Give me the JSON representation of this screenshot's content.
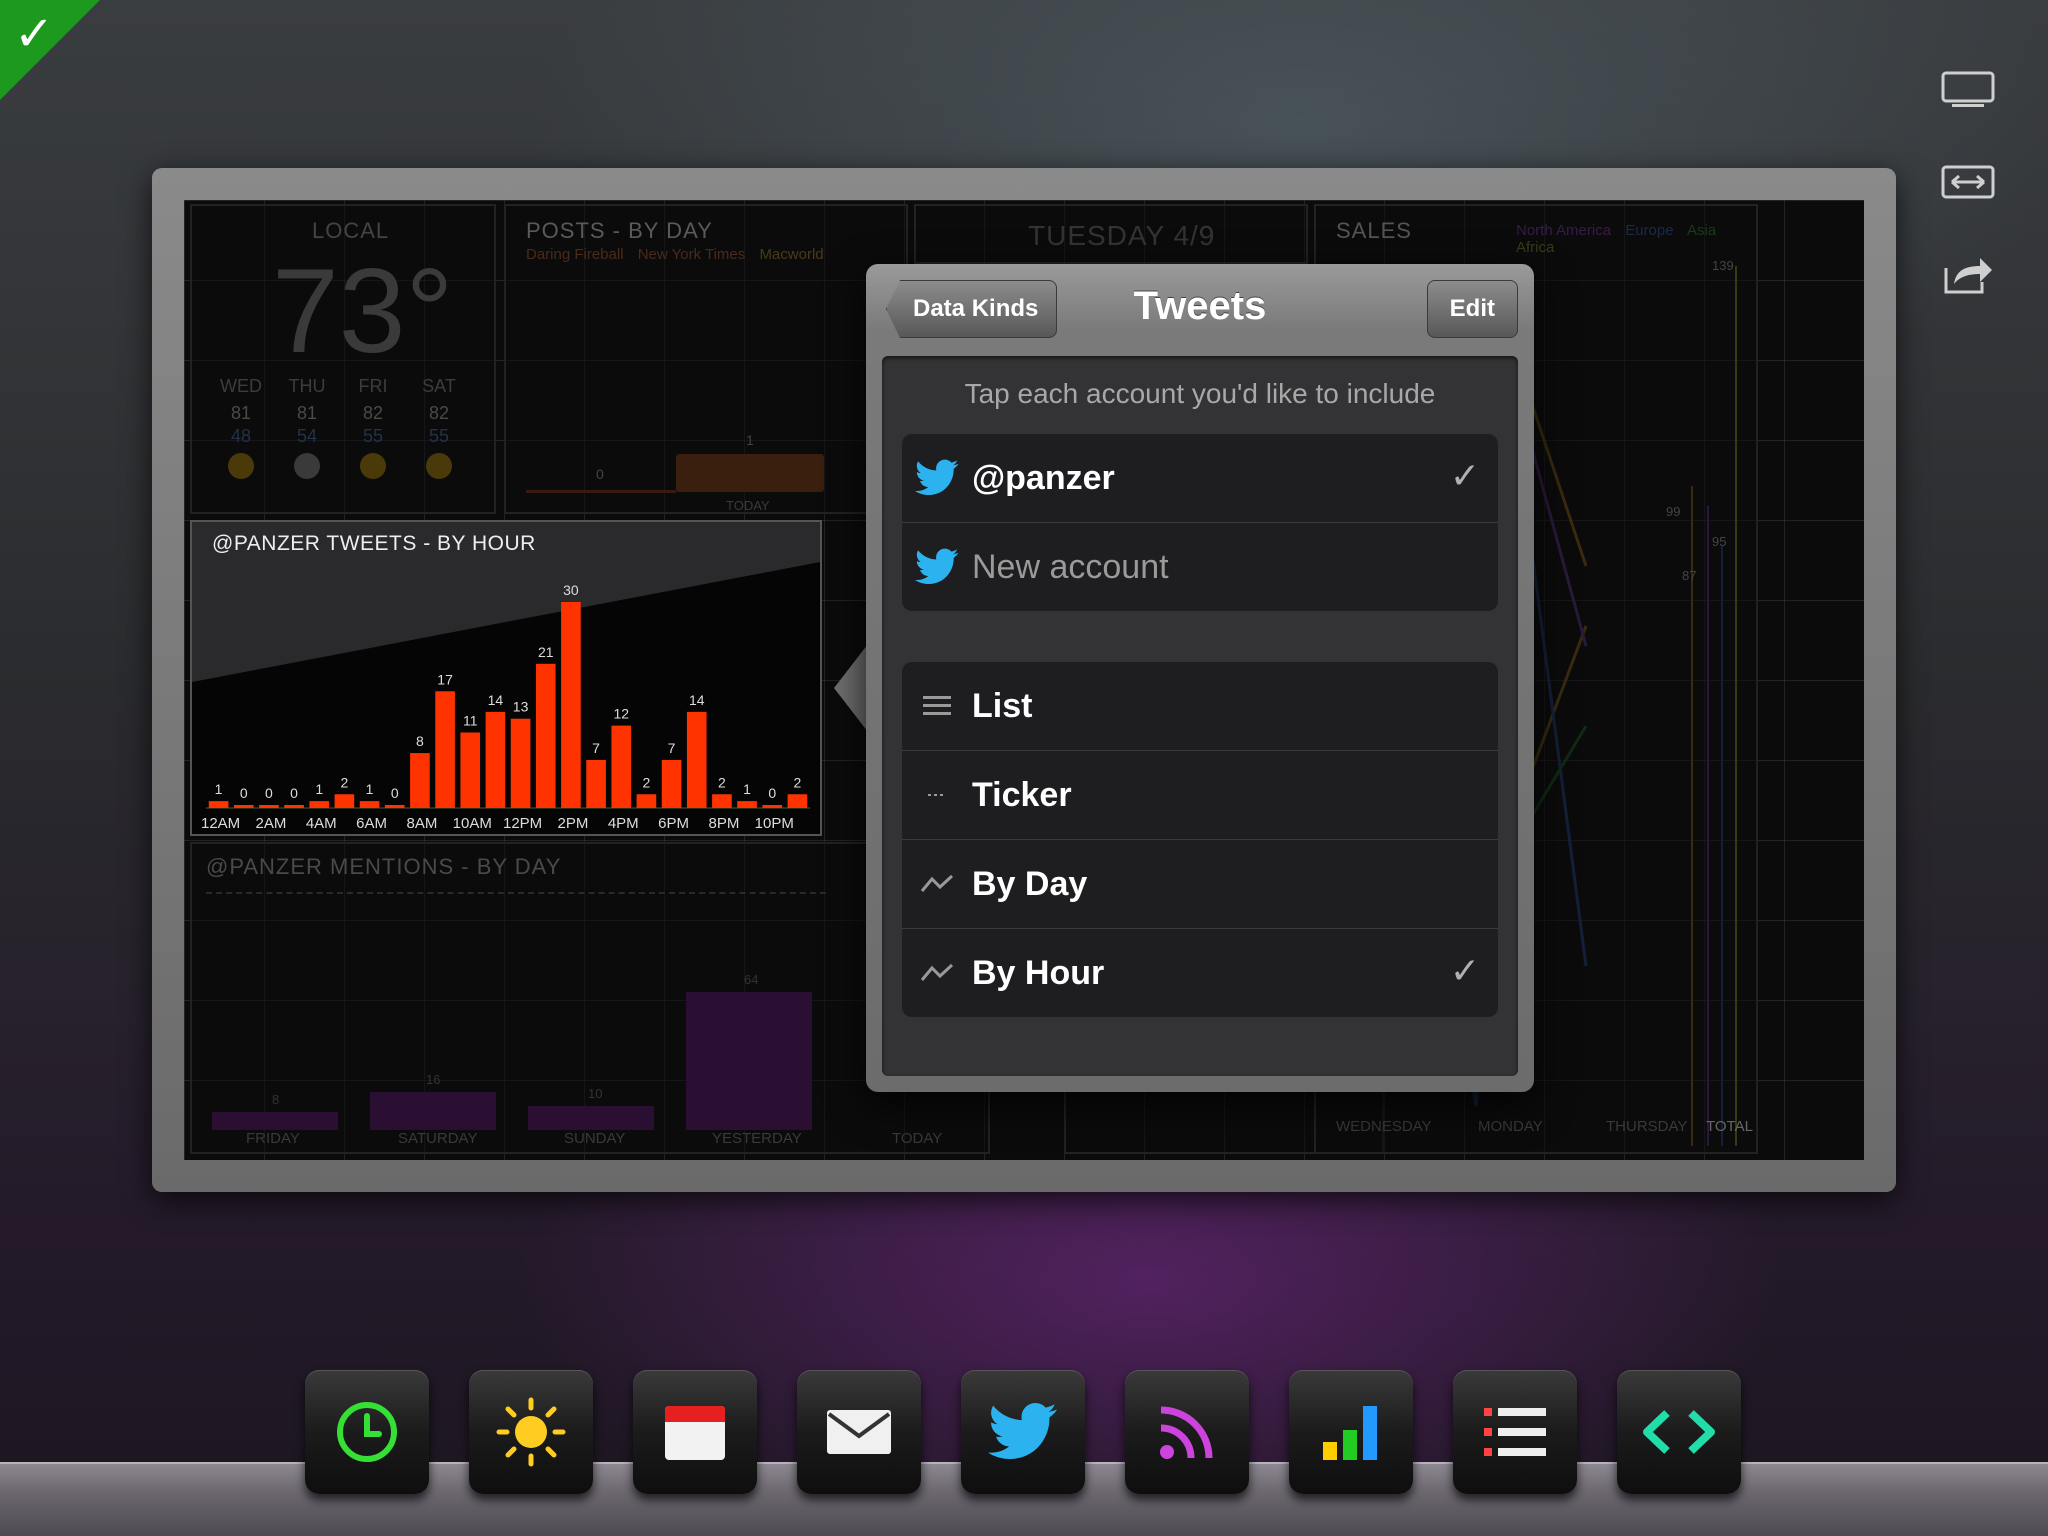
{
  "dashboard": {
    "weather": {
      "label": "LOCAL",
      "temp": "73°",
      "days": [
        {
          "day": "WED",
          "high": "81",
          "low": "48"
        },
        {
          "day": "THU",
          "high": "81",
          "low": "54"
        },
        {
          "day": "FRI",
          "high": "82",
          "low": "55"
        },
        {
          "day": "SAT",
          "high": "82",
          "low": "55"
        }
      ]
    },
    "posts": {
      "title": "POSTS - BY DAY",
      "legend": [
        "Daring Fireball",
        "New York Times",
        "Macworld"
      ],
      "zero": "0",
      "one": "1",
      "today": "TODAY"
    },
    "date_panel": {
      "title": "TUESDAY 4/9"
    },
    "sales": {
      "title": "SALES",
      "legend": [
        "North America",
        "Europe",
        "Asia",
        "Africa"
      ],
      "values": [
        "139",
        "99",
        "95",
        "87"
      ],
      "xlabels": [
        "WEDNESDAY",
        "MONDAY",
        "THURSDAY",
        "TOTAL"
      ]
    },
    "mentions": {
      "title": "@PANZER MENTIONS - BY DAY",
      "values": [
        "8",
        "16",
        "10",
        "64"
      ],
      "xlabels": [
        "FRIDAY",
        "SATURDAY",
        "SUNDAY",
        "YESTERDAY",
        "TODAY"
      ]
    }
  },
  "chart_data": {
    "type": "bar",
    "title": "@PANZER TWEETS - BY HOUR",
    "categories": [
      "12AM",
      "1AM",
      "2AM",
      "3AM",
      "4AM",
      "5AM",
      "6AM",
      "7AM",
      "8AM",
      "9AM",
      "10AM",
      "11AM",
      "12PM",
      "1PM",
      "2PM",
      "3PM",
      "4PM",
      "5PM",
      "6PM",
      "7PM",
      "8PM",
      "9PM",
      "10PM",
      "11PM"
    ],
    "values": [
      1,
      0,
      0,
      0,
      1,
      2,
      1,
      0,
      8,
      17,
      11,
      14,
      13,
      21,
      30,
      7,
      12,
      2,
      7,
      14,
      2,
      1,
      0,
      2
    ],
    "tick_labels": [
      "12AM",
      "2AM",
      "4AM",
      "6AM",
      "8AM",
      "10AM",
      "12PM",
      "2PM",
      "4PM",
      "6PM",
      "8PM",
      "10PM"
    ],
    "ylim": [
      0,
      30
    ],
    "bar_color": "#ff3300"
  },
  "popover": {
    "title": "Tweets",
    "back_label": "Data Kinds",
    "edit_label": "Edit",
    "hint": "Tap each account you'd like to include",
    "accounts": [
      {
        "label": "@panzer",
        "checked": true
      },
      {
        "label": "New account",
        "checked": false
      }
    ],
    "kinds": [
      {
        "label": "List",
        "icon": "list-icon",
        "checked": false
      },
      {
        "label": "Ticker",
        "icon": "ticker-icon",
        "checked": false
      },
      {
        "label": "By Day",
        "icon": "line-chart-icon",
        "checked": false
      },
      {
        "label": "By Hour",
        "icon": "line-chart-icon",
        "checked": true
      }
    ],
    "checkmark": "✓"
  },
  "corner": {
    "mark": "✓",
    "color": "#1d9a1d"
  },
  "dock": [
    "clock-icon",
    "sun-icon",
    "calendar-icon",
    "mail-icon",
    "twitter-icon",
    "rss-icon",
    "bar-chart-icon",
    "list-icon",
    "code-icon"
  ]
}
